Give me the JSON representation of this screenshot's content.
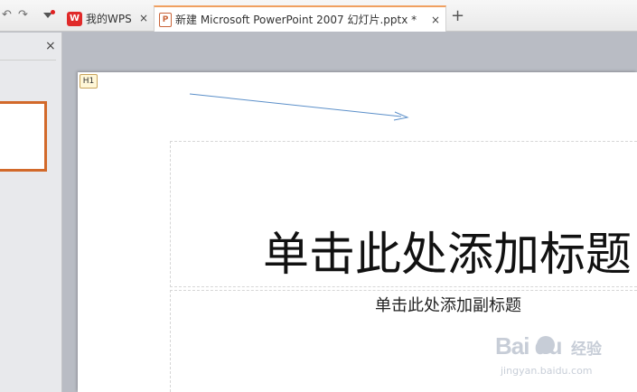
{
  "tabs": [
    {
      "label": "我的WPS",
      "icon": "wps-logo-icon",
      "active": false
    },
    {
      "label": "新建 Microsoft PowerPoint 2007 幻灯片.pptx *",
      "icon": "ppt-file-icon",
      "active": true
    }
  ],
  "new_tab_symbol": "+",
  "close_symbol": "×",
  "quick_access": {
    "undo": "↶",
    "redo": "↷"
  },
  "logos": {
    "wps": "W",
    "ppt": "P"
  },
  "slide": {
    "layout_tag": "H1",
    "title_placeholder": "单击此处添加标题",
    "subtitle_placeholder": "单击此处添加副标题"
  },
  "watermark": {
    "brand": "Bai du",
    "brand_cn": "经验",
    "url": "jingyan.baidu.com"
  },
  "colors": {
    "accent": "#d2692a",
    "arrow": "#5b8fc9",
    "wps_red": "#e02a2a"
  }
}
